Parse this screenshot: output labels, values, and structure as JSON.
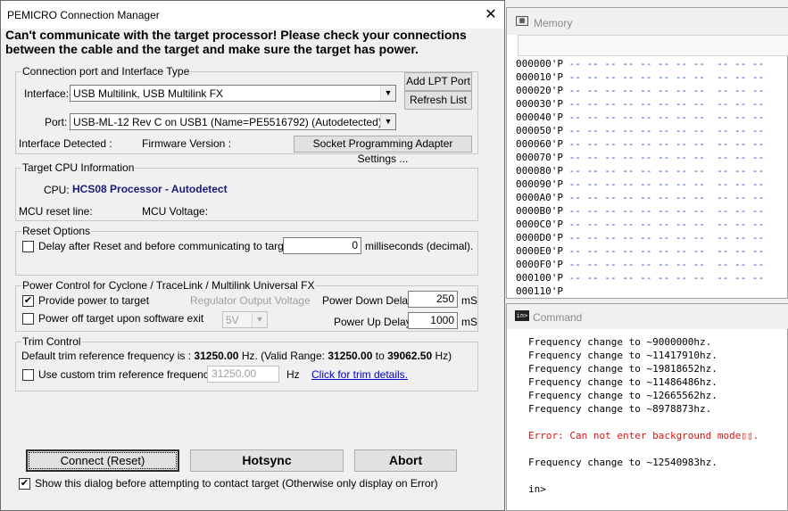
{
  "dialog": {
    "title": "PEMICRO Connection Manager",
    "error_line1": "Can't communicate with the target processor! Please check your connections",
    "error_line2": "between the cable and the target and make sure the target has power.",
    "connection": {
      "group_label": "Connection port and Interface Type",
      "interface_label": "Interface:",
      "interface_value": "USB Multilink, USB Multilink FX",
      "port_label": "Port:",
      "port_value": "USB-ML-12 Rev C on USB1 (Name=PE5516792) (Autodetected)",
      "add_lpt": "Add LPT Port",
      "refresh": "Refresh List",
      "interface_detected": "Interface Detected :",
      "firmware_version": "Firmware Version :",
      "socket_btn": "Socket Programming Adapter Settings ..."
    },
    "cpu": {
      "group_label": "Target CPU Information",
      "cpu_label": "CPU:",
      "cpu_value": "HCS08 Processor - Autodetect",
      "reset_line": "MCU reset line:",
      "voltage": "MCU Voltage:"
    },
    "reset": {
      "group_label": "Reset Options",
      "delay_label": "Delay after Reset and before communicating to target for",
      "delay_value": "0",
      "delay_unit": "milliseconds (decimal).",
      "delay_checked": false
    },
    "power": {
      "group_label": "Power Control for Cyclone / TraceLink / Multilink Universal FX",
      "provide_label": "Provide power to target",
      "provide_checked": true,
      "regulator_label": "Regulator Output Voltage",
      "down_label": "Power Down Delay",
      "down_value": "250",
      "down_unit": "mS",
      "poweroff_label": "Power off target upon software exit",
      "poweroff_checked": false,
      "voltage_value": "5V",
      "up_label": "Power Up Delay",
      "up_value": "1000",
      "up_unit": "mS"
    },
    "trim": {
      "group_label": "Trim Control",
      "default_prefix": "Default trim reference frequency is :",
      "default_value": "31250.00",
      "default_mid": "Hz. (Valid Range:",
      "range_low": "31250.00",
      "range_to": "to",
      "range_high": "39062.50",
      "range_unit": "Hz)",
      "custom_label": "Use custom trim reference frequency :",
      "custom_checked": false,
      "custom_value": "31250.00",
      "custom_unit": "Hz",
      "details_link": "Click for trim details."
    },
    "buttons": {
      "connect": "Connect (Reset)",
      "hotsync": "Hotsync",
      "abort": "Abort"
    },
    "show_dialog_label": "Show this dialog before attempting to contact target (Otherwise only display on Error)",
    "show_dialog_checked": true
  },
  "memory": {
    "title": "Memory",
    "rows": [
      {
        "addr": "000000'P",
        "cells": "-- -- -- -- -- -- -- --  -- -- --"
      },
      {
        "addr": "000010'P",
        "cells": "-- -- -- -- -- -- -- --  -- -- --"
      },
      {
        "addr": "000020'P",
        "cells": "-- -- -- -- -- -- -- --  -- -- --"
      },
      {
        "addr": "000030'P",
        "cells": "-- -- -- -- -- -- -- --  -- -- --"
      },
      {
        "addr": "000040'P",
        "cells": "-- -- -- -- -- -- -- --  -- -- --"
      },
      {
        "addr": "000050'P",
        "cells": "-- -- -- -- -- -- -- --  -- -- --"
      },
      {
        "addr": "000060'P",
        "cells": "-- -- -- -- -- -- -- --  -- -- --"
      },
      {
        "addr": "000070'P",
        "cells": "-- -- -- -- -- -- -- --  -- -- --"
      },
      {
        "addr": "000080'P",
        "cells": "-- -- -- -- -- -- -- --  -- -- --"
      },
      {
        "addr": "000090'P",
        "cells": "-- -- -- -- -- -- -- --  -- -- --"
      },
      {
        "addr": "0000A0'P",
        "cells": "-- -- -- -- -- -- -- --  -- -- --"
      },
      {
        "addr": "0000B0'P",
        "cells": "-- -- -- -- -- -- -- --  -- -- --"
      },
      {
        "addr": "0000C0'P",
        "cells": "-- -- -- -- -- -- -- --  -- -- --"
      },
      {
        "addr": "0000D0'P",
        "cells": "-- -- -- -- -- -- -- --  -- -- --"
      },
      {
        "addr": "0000E0'P",
        "cells": "-- -- -- -- -- -- -- --  -- -- --"
      },
      {
        "addr": "0000F0'P",
        "cells": "-- -- -- -- -- -- -- --  -- -- --"
      },
      {
        "addr": "000100'P",
        "cells": "-- -- -- -- -- -- -- --  -- -- --"
      },
      {
        "addr": "000110'P",
        "cells": ""
      }
    ]
  },
  "command": {
    "title": "Command",
    "lines": [
      {
        "text": "Frequency change to ~9000000hz.",
        "color": "#000000"
      },
      {
        "text": "Frequency change to ~11417910hz.",
        "color": "#000000"
      },
      {
        "text": "Frequency change to ~19818652hz.",
        "color": "#000000"
      },
      {
        "text": "Frequency change to ~11486486hz.",
        "color": "#000000"
      },
      {
        "text": "Frequency change to ~12665562hz.",
        "color": "#000000"
      },
      {
        "text": "Frequency change to ~8978873hz.",
        "color": "#000000"
      },
      {
        "text": "",
        "color": "#000000"
      },
      {
        "text": "Error: Can not enter background mode▯▯.",
        "color": "#e01010"
      },
      {
        "text": "",
        "color": "#000000"
      },
      {
        "text": "Frequency change to ~12540983hz.",
        "color": "#000000"
      },
      {
        "text": "",
        "color": "#000000"
      },
      {
        "text": "in>",
        "color": "#000000"
      }
    ]
  },
  "colors": {
    "cpu_value": "#1a1a7a",
    "link": "#0000cc",
    "memory_dash": "#1a3ccc",
    "error": "#e01010"
  }
}
